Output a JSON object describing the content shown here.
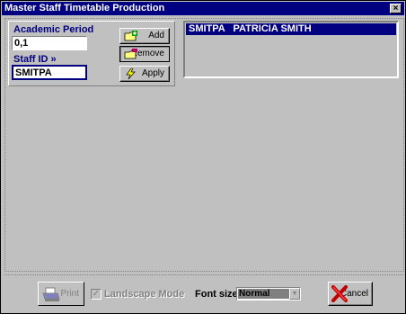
{
  "window": {
    "title": "Master Staff Timetable Production",
    "close_label": "×"
  },
  "form": {
    "academic_period_label": "Academic Period",
    "academic_period_value": "0,1",
    "staff_id_label": "Staff ID »",
    "staff_id_value": "SMITPA"
  },
  "buttons": {
    "add": "Add",
    "remove": "Remove",
    "apply": "Apply",
    "print": "Print",
    "cancel": "Cancel"
  },
  "selected_staff": [
    {
      "code": "SMITPA",
      "name": "PATRICIA SMITH",
      "display": "SMITPA   PATRICIA SMITH"
    }
  ],
  "options": {
    "landscape_label": "Landscape Mode",
    "landscape_checked": true,
    "font_size_label": "Font size",
    "font_size_value": "Normal"
  },
  "icons": {
    "add": "folder-add-icon",
    "remove": "folder-remove-icon",
    "apply": "lightning-icon",
    "print": "printer-icon",
    "cancel": "red-x-icon"
  },
  "colors": {
    "titlebar": "#000080",
    "selection": "#000080",
    "face": "#c0c0c0"
  }
}
